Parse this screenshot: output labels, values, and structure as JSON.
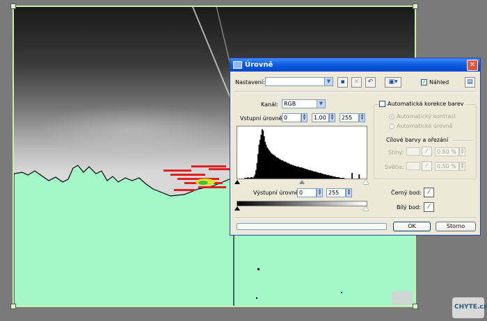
{
  "dialog": {
    "title": "Úrovně",
    "close_glyph": "✕",
    "preset": {
      "label": "Nastavení:",
      "value": ""
    },
    "preview": {
      "label": "Náhled",
      "checked": true
    },
    "channel": {
      "label": "Kanál:",
      "value": "RGB"
    },
    "input_levels": {
      "label": "Vstupní úrovně:",
      "black": "0",
      "gamma": "1.00",
      "white": "255"
    },
    "output_levels": {
      "label": "Výstupní úrovně:",
      "black": "0",
      "white": "255"
    },
    "auto_color": {
      "label": "Automatická korekce barev",
      "checked": false
    },
    "auto_contrast": {
      "label": "Automatický kontrast",
      "selected": true
    },
    "auto_levels": {
      "label": "Automatické úrovně",
      "selected": false
    },
    "target_group": {
      "label": "Cílové barvy a ořezání"
    },
    "shadows": {
      "label": "Stíny:",
      "value": "0.50 %"
    },
    "highlights": {
      "label": "Světla:",
      "value": "0.50 %"
    },
    "black_point": {
      "label": "Černý bod:"
    },
    "white_point": {
      "label": "Bílý bod:"
    },
    "ok_label": "OK",
    "cancel_label": "Storno",
    "progress": 0
  },
  "histogram_levels": [
    0,
    0,
    0,
    0,
    0,
    0,
    0,
    1,
    1,
    1,
    2,
    1,
    1,
    2,
    2,
    1,
    3,
    6,
    12,
    22,
    35,
    48,
    55,
    62,
    70,
    68,
    60,
    52,
    48,
    44,
    42,
    40,
    38,
    36,
    35,
    34,
    33,
    32,
    30,
    30,
    29,
    28,
    27,
    26,
    26,
    25,
    24,
    24,
    23,
    22,
    22,
    21,
    20,
    20,
    19,
    19,
    18,
    18,
    17,
    17,
    17,
    16,
    16,
    16,
    15,
    15,
    14,
    14,
    13,
    13,
    12,
    12,
    12,
    11,
    11,
    10,
    10,
    10,
    9,
    9,
    8,
    8,
    8,
    7,
    7,
    6,
    6,
    6,
    5,
    5,
    5,
    4,
    4,
    4,
    3,
    3,
    3,
    2,
    2,
    2,
    2,
    1,
    1,
    1,
    1,
    1,
    0,
    0,
    0,
    0,
    0,
    0,
    0,
    8,
    0,
    0,
    0,
    0,
    0,
    0,
    6,
    0,
    0,
    0,
    0,
    0,
    0,
    0
  ],
  "watermark": {
    "text": "CHYTE.cz"
  }
}
